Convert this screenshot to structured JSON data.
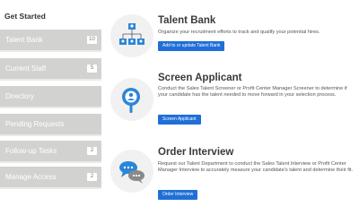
{
  "sidebar": {
    "title": "Get Started",
    "items": [
      {
        "label": "Talent Bank",
        "badge": "10"
      },
      {
        "label": "Current Staff",
        "badge": "5"
      },
      {
        "label": "Directory",
        "badge": ""
      },
      {
        "label": "Pending Requests",
        "badge": ""
      },
      {
        "label": "Follow-up Tasks",
        "badge": "2"
      },
      {
        "label": "Manage Access",
        "badge": "2"
      }
    ]
  },
  "sections": {
    "talent_bank": {
      "icon": "org-chart-icon",
      "title": "Talent Bank",
      "description": "Organize your recruitment efforts to track and qualify your potential hires.",
      "button": "Add to or update Talent Bank"
    },
    "screen_applicant": {
      "icon": "person-magnifier-icon",
      "title": "Screen Applicant",
      "description": "Conduct the Sales Talent Screener or Profit Center Manager Screener to determine if your candidate has the talent needed to move forward in your selection process.",
      "button": "Screen Applicant"
    },
    "order_interview": {
      "icon": "chat-bubbles-icon",
      "title": "Order Interview",
      "description": "Request our Talent Department to conduct the Sales Talent Interview or Profit Center Manager Interview to accurately measure your candidate's talent and determine their fit.",
      "button": "Order Interview"
    }
  },
  "colors": {
    "sidebar_item_bg": "#d2d2d0",
    "button_blue": "#1f6fd6",
    "icon_blue": "#2b86d6"
  }
}
